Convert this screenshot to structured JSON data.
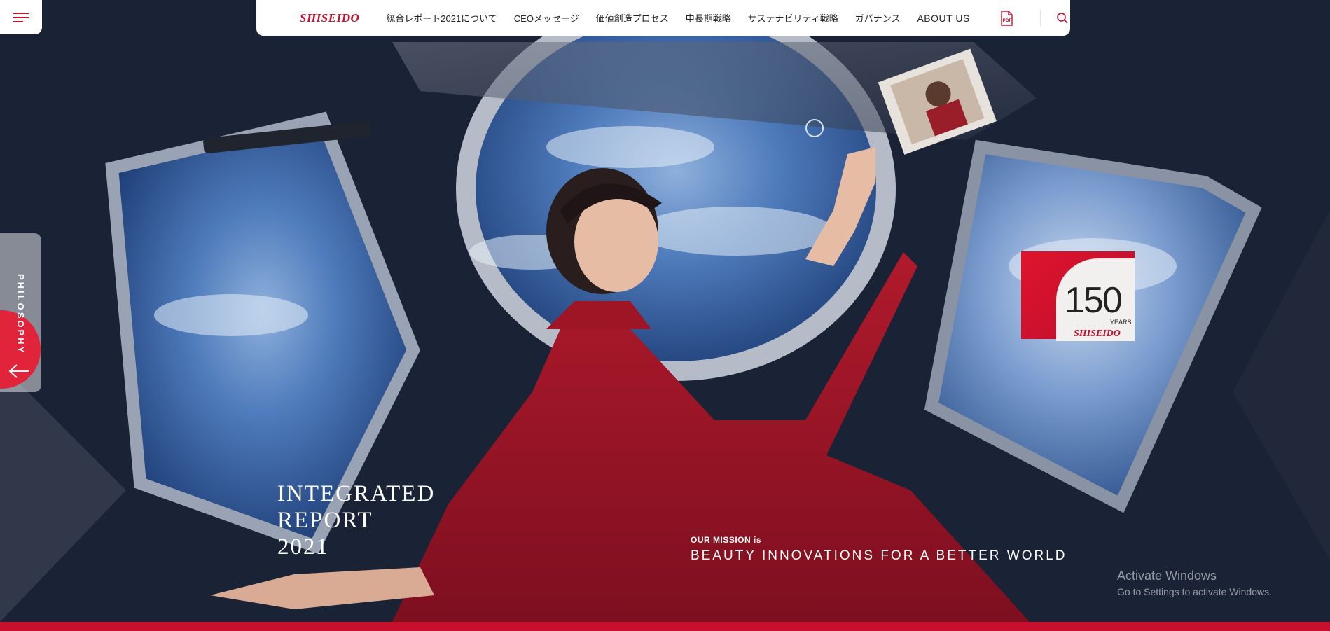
{
  "brand": {
    "name": "SHISEIDO",
    "accent": "#c8102e"
  },
  "header": {
    "nav_items": [
      "統合レポート2021について",
      "CEOメッセージ",
      "価値創造プロセス",
      "中長期戦略",
      "サステナビリティ戦略",
      "ガバナンス",
      "ABOUT US"
    ],
    "pdf_icon": "pdf-icon",
    "search_icon": "search-icon",
    "menu_icon": "hamburger-menu-icon"
  },
  "side_tab": {
    "label": "PHILOSOPHY",
    "icon": "arrow-left-icon"
  },
  "hero": {
    "title_lines": [
      "INTEGRATED",
      "REPORT",
      "2021"
    ],
    "mission_small": "OUR MISSION is",
    "mission_big": "BEAUTY INNOVATIONS FOR A BETTER WORLD"
  },
  "badge": {
    "number": "150",
    "unit": "YEARS",
    "logo": "SHISEIDO"
  },
  "watermark": {
    "title": "Activate Windows",
    "subtitle": "Go to Settings to activate Windows."
  }
}
